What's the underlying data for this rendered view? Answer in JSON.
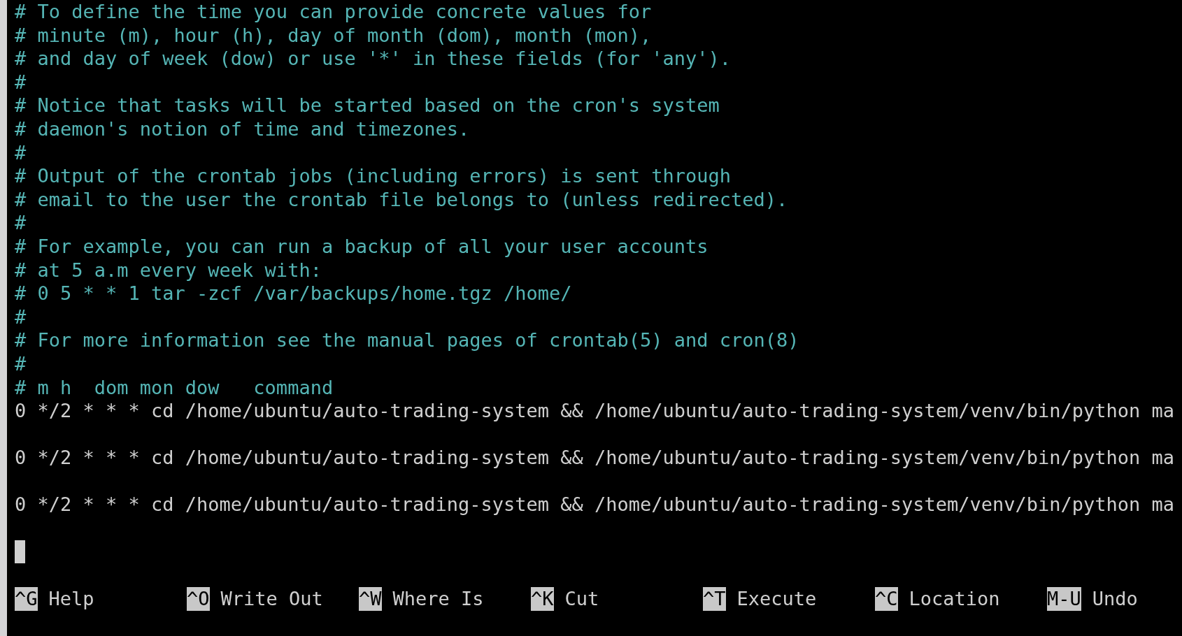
{
  "editor": {
    "lines": [
      {
        "kind": "comment",
        "text": "# To define the time you can provide concrete values for"
      },
      {
        "kind": "comment",
        "text": "# minute (m), hour (h), day of month (dom), month (mon),"
      },
      {
        "kind": "comment",
        "text": "# and day of week (dow) or use '*' in these fields (for 'any')."
      },
      {
        "kind": "comment",
        "text": "#"
      },
      {
        "kind": "comment",
        "text": "# Notice that tasks will be started based on the cron's system"
      },
      {
        "kind": "comment",
        "text": "# daemon's notion of time and timezones."
      },
      {
        "kind": "comment",
        "text": "#"
      },
      {
        "kind": "comment",
        "text": "# Output of the crontab jobs (including errors) is sent through"
      },
      {
        "kind": "comment",
        "text": "# email to the user the crontab file belongs to (unless redirected)."
      },
      {
        "kind": "comment",
        "text": "#"
      },
      {
        "kind": "comment",
        "text": "# For example, you can run a backup of all your user accounts"
      },
      {
        "kind": "comment",
        "text": "# at 5 a.m every week with:"
      },
      {
        "kind": "comment",
        "text": "# 0 5 * * 1 tar -zcf /var/backups/home.tgz /home/"
      },
      {
        "kind": "comment",
        "text": "#"
      },
      {
        "kind": "comment",
        "text": "# For more information see the manual pages of crontab(5) and cron(8)"
      },
      {
        "kind": "comment",
        "text": "#"
      },
      {
        "kind": "comment",
        "text": "# m h  dom mon dow   command"
      },
      {
        "kind": "command",
        "text": "0 */2 * * * cd /home/ubuntu/auto-trading-system && /home/ubuntu/auto-trading-system/venv/bin/python ma"
      },
      {
        "kind": "blank"
      },
      {
        "kind": "command",
        "text": "0 */2 * * * cd /home/ubuntu/auto-trading-system && /home/ubuntu/auto-trading-system/venv/bin/python ma"
      },
      {
        "kind": "blank"
      },
      {
        "kind": "command",
        "text": "0 */2 * * * cd /home/ubuntu/auto-trading-system && /home/ubuntu/auto-trading-system/venv/bin/python ma"
      },
      {
        "kind": "blank"
      },
      {
        "kind": "cursor"
      },
      {
        "kind": "blank"
      }
    ]
  },
  "shortcuts": [
    {
      "key": "^G",
      "label": "Help"
    },
    {
      "key": "^O",
      "label": "Write Out"
    },
    {
      "key": "^W",
      "label": "Where Is"
    },
    {
      "key": "^K",
      "label": "Cut"
    },
    {
      "key": "^T",
      "label": "Execute"
    },
    {
      "key": "^C",
      "label": "Location"
    },
    {
      "key": "M-U",
      "label": "Undo"
    }
  ]
}
